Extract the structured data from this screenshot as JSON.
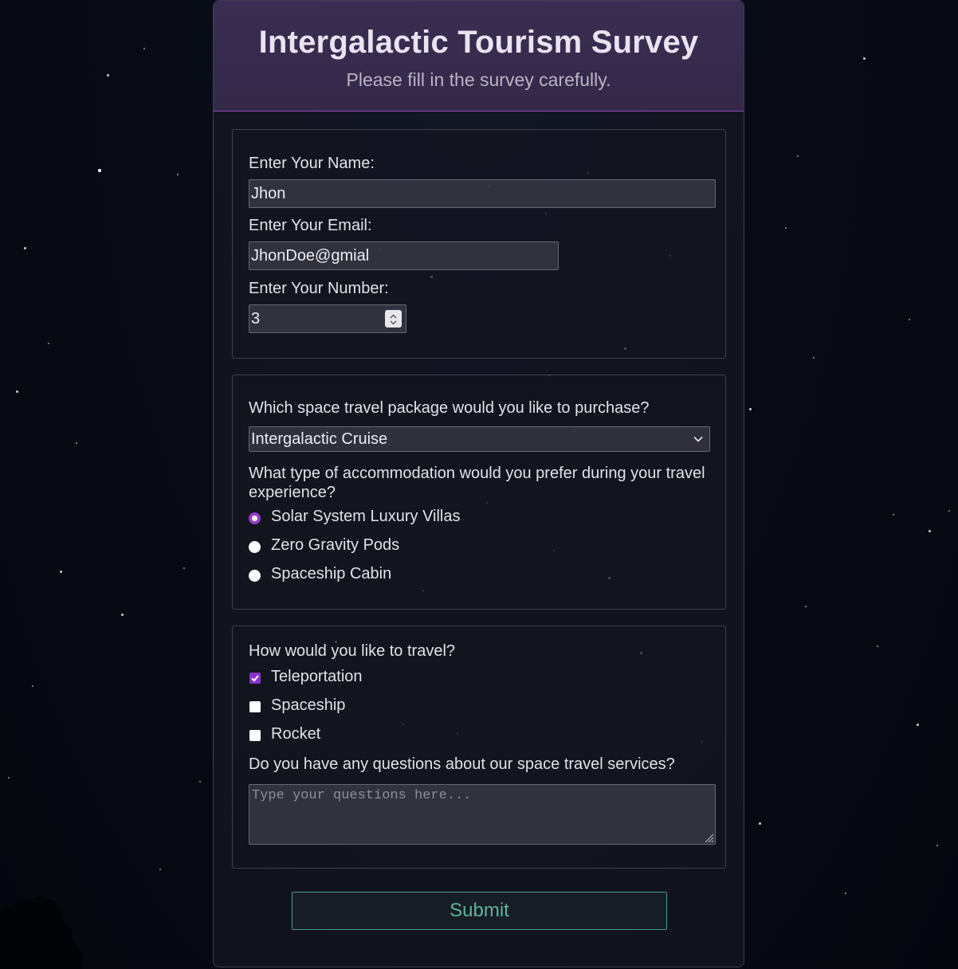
{
  "header": {
    "title": "Intergalactic Tourism Survey",
    "subtitle": "Please fill in the survey carefully."
  },
  "personal": {
    "name_label": "Enter Your Name:",
    "name_value": "Jhon",
    "email_label": "Enter Your Email:",
    "email_value": "JhonDoe@gmial",
    "number_label": "Enter Your Number:",
    "number_value": "3"
  },
  "preferences": {
    "package_question": "Which space travel package would you like to purchase?",
    "package_selected": "Intergalactic Cruise",
    "accommodation_question": "What type of accommodation would you prefer during your travel experience?",
    "accommodation_options": [
      {
        "label": "Solar System Luxury Villas",
        "checked": true
      },
      {
        "label": "Zero Gravity Pods",
        "checked": false
      },
      {
        "label": "Spaceship Cabin",
        "checked": false
      }
    ]
  },
  "travel": {
    "travel_question": "How would you like to travel?",
    "travel_options": [
      {
        "label": "Teleportation",
        "checked": true
      },
      {
        "label": "Spaceship",
        "checked": false
      },
      {
        "label": "Rocket",
        "checked": false
      }
    ],
    "questions_label": "Do you have any questions about our space travel services?",
    "questions_placeholder": "Type your questions here..."
  },
  "submit_label": "Submit",
  "colors": {
    "accent": "#8b32c9",
    "header_border": "#8a4ab5",
    "submit_text": "#5fb29c"
  }
}
